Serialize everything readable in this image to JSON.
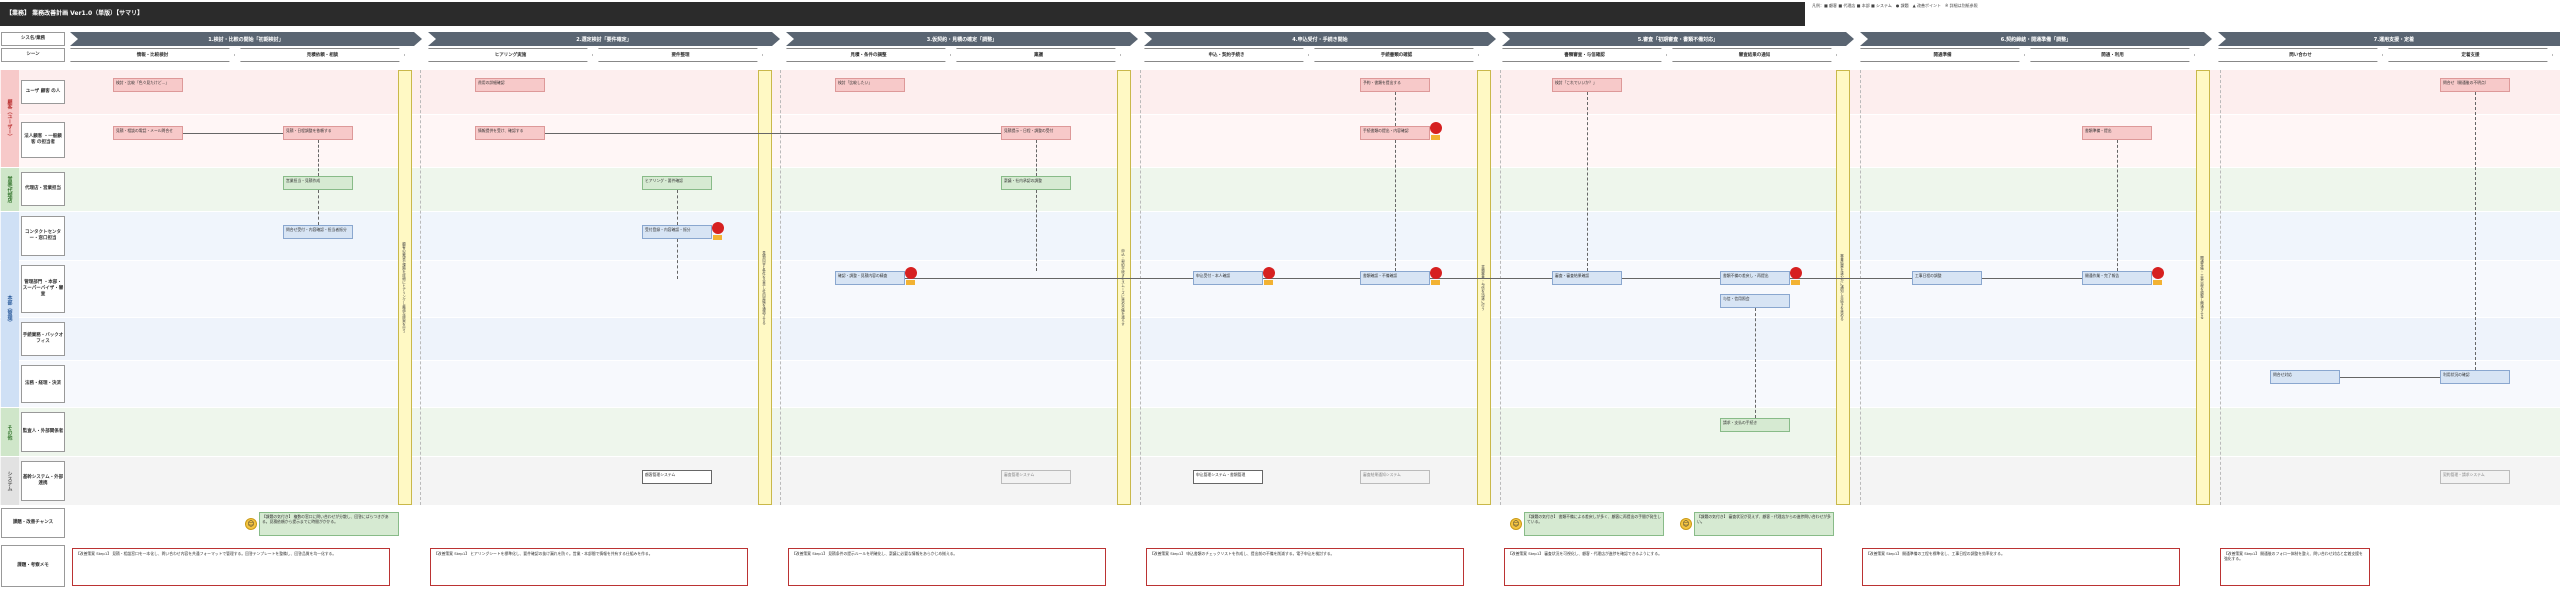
{
  "header": {
    "title": "【業務】 業務改善計画 Ver1.0（単版）【サマリ】",
    "legend": "凡例：■ 顧客 ■ 代理店 ■ 本部 ■ システム　● 課題　▲ 改善ポイント　※ 詳細は別紙参照"
  },
  "row_labels": {
    "system_name": "シス名/業務",
    "scene": "シーン",
    "customer_group": "顧客（ユーザー）",
    "sales_group": "営業/代理店",
    "hq_group": "本部（管理）",
    "admin_group": "その他",
    "it_group": "システム",
    "lanes": [
      "ユーザ 顧客 の人",
      "法人顧客 ・一般顧客 の担当者",
      "代理店・営業担当",
      "コンタクトセンター・窓口担当",
      "管理部門 ・本部・スーパーバイザ・審査",
      "手続業務・バックオフィス",
      "法務・経理・決済",
      "監査人・外部関係者",
      "基幹システム・外部連携"
    ],
    "issues": "課題・改善チャンス",
    "notes": "課題・考察メモ"
  },
  "phases": [
    {
      "label": "1.検討・比較の開始「初期検討」",
      "subs": [
        "情報・比較検討",
        "見積依頼・相談"
      ]
    },
    {
      "label": "2.選定検討「要件確定」",
      "subs": [
        "ヒアリング実施",
        "要件整理"
      ]
    },
    {
      "label": "3.仮契約・見積の確定「調整」",
      "subs": [
        "見積・条件の調整",
        "稟議"
      ]
    },
    {
      "label": "4.申込受付・手続き開始",
      "subs": [
        "申込・契約手続き",
        "手続書類の確認"
      ]
    },
    {
      "label": "5.審査「初期審査・書類不備対応」",
      "subs": [
        "書類審査・与信確認",
        "審査結果の通知"
      ]
    },
    {
      "label": "6.契約締結・開通準備「調整」",
      "subs": [
        "開通準備",
        "開通・利用"
      ]
    },
    {
      "label": "7.運用支援・定着",
      "subs": [
        "問い合わせ",
        "定着支援"
      ]
    }
  ],
  "boxes": [
    {
      "text": "検討・比較「色々見たけど…」",
      "style": "pink"
    },
    {
      "text": "見積・相談の電話・メール問合せ",
      "style": "pink"
    },
    {
      "text": "見積・日程調整を依頼する",
      "style": "pink"
    },
    {
      "text": "情報提供を受け、確認する",
      "style": "pink"
    },
    {
      "text": "費用の詳細確認",
      "style": "pink"
    },
    {
      "text": "検討「比較したい」",
      "style": "pink"
    },
    {
      "text": "見積提示・日程・調整の受付",
      "style": "pink"
    },
    {
      "text": "予約・書類を提出する",
      "style": "pink"
    },
    {
      "text": "手続書類の提出・内容確認",
      "style": "pink"
    },
    {
      "text": "検討「これでいいか？」",
      "style": "pink"
    },
    {
      "text": "書類準備・提出",
      "style": "pink"
    },
    {
      "text": "問合せ（開通後の不明点）",
      "style": "pink"
    },
    {
      "text": "営業担当・見積作成",
      "style": "green"
    },
    {
      "text": "ヒアリング・要件確認",
      "style": "green"
    },
    {
      "text": "稟議・社内承認の調整",
      "style": "green"
    },
    {
      "text": "問合せ受付・内容確認・担当者振分",
      "style": "blue"
    },
    {
      "text": "受付登録・内容確認・振分",
      "style": "blue"
    },
    {
      "text": "確認・調整・見積内容の精査",
      "style": "blue"
    },
    {
      "text": "申込受付・本人確認",
      "style": "blue"
    },
    {
      "text": "書類確認・不備確認",
      "style": "blue"
    },
    {
      "text": "審査・審査結果確認",
      "style": "blue"
    },
    {
      "text": "書類不備の差戻し・再提出",
      "style": "blue"
    },
    {
      "text": "与信・信用照会",
      "style": "blue"
    },
    {
      "text": "工事日程の調整",
      "style": "blue"
    },
    {
      "text": "開通作業・完了報告",
      "style": "blue"
    },
    {
      "text": "問合せ対応",
      "style": "blue"
    },
    {
      "text": "利用状況の確認",
      "style": "blue"
    },
    {
      "text": "請求・支払の手続き",
      "style": "green"
    },
    {
      "text": "顧客管理システム",
      "style": "white"
    },
    {
      "text": "申込管理システム・書類管理",
      "style": "white"
    },
    {
      "text": "審査管理システム",
      "style": "grey"
    },
    {
      "text": "審査結果通知システム",
      "style": "grey"
    },
    {
      "text": "契約管理・請求システム",
      "style": "grey"
    }
  ],
  "vbars": [
    "顧客の要望や課題を詳細にヒアリングし最適な提案を行う",
    "見積内容と条件を合意し社内稟議を通過させる",
    "申込・契約手続きをスムーズに進め不備を減らす",
    "書類審査・与信を迅速に行う",
    "審査結果を速やかに通知し手続きを進める",
    "開通準備・工事日程を調整し開通させる",
    "開通後の問い合わせ・定着を支援する"
  ],
  "issues": [
    "【課題の気付き】 複数の窓口に問い合わせが分散し、回答にばらつきがある。見積依頼から提示までに時間がかかる。",
    "【課題の気付き】 書類不備による差戻しが多く、顧客に再提出の手間が発生している。",
    "【課題の気付き】 審査状況が見えず、顧客・代理店からの進捗問い合わせが多い。"
  ],
  "notes": [
    "【改善策案 Step1】 見積・相談窓口を一本化し、問い合わせ内容を共通フォーマットで管理する。回答テンプレートを整備し、回答品質を均一化する。",
    "【改善策案 Step1】 ヒアリングシートを標準化し、要件確認の抜け漏れを防ぐ。営業・本部間で情報を共有する仕組みを作る。",
    "【改善策案 Step1】 見積条件の提示ルールを明確化し、稟議に必要な情報をあらかじめ揃える。",
    "【改善策案 Step1】 申込書類のチェックリストを作成し、提出前の不備を削減する。電子申込を検討する。",
    "【改善策案 Step1】 審査状況を可視化し、顧客・代理店が進捗を確認できるようにする。",
    "【改善策案 Step1】 開通準備の工程を標準化し、工事日程の調整を効率化する。",
    "【改善策案 Step1】 開通後のフォロー体制を整え、問い合わせ対応と定着支援を強化する。"
  ],
  "colors": {
    "title_bg": "#2b2b2b",
    "phase_chevron": "#5a6572",
    "customer_band": "#fdeeee",
    "sales_band": "#eef6ec",
    "hq_band": "#eef3fb",
    "issue_flag": "#d62020",
    "note_border": "#b33333"
  }
}
